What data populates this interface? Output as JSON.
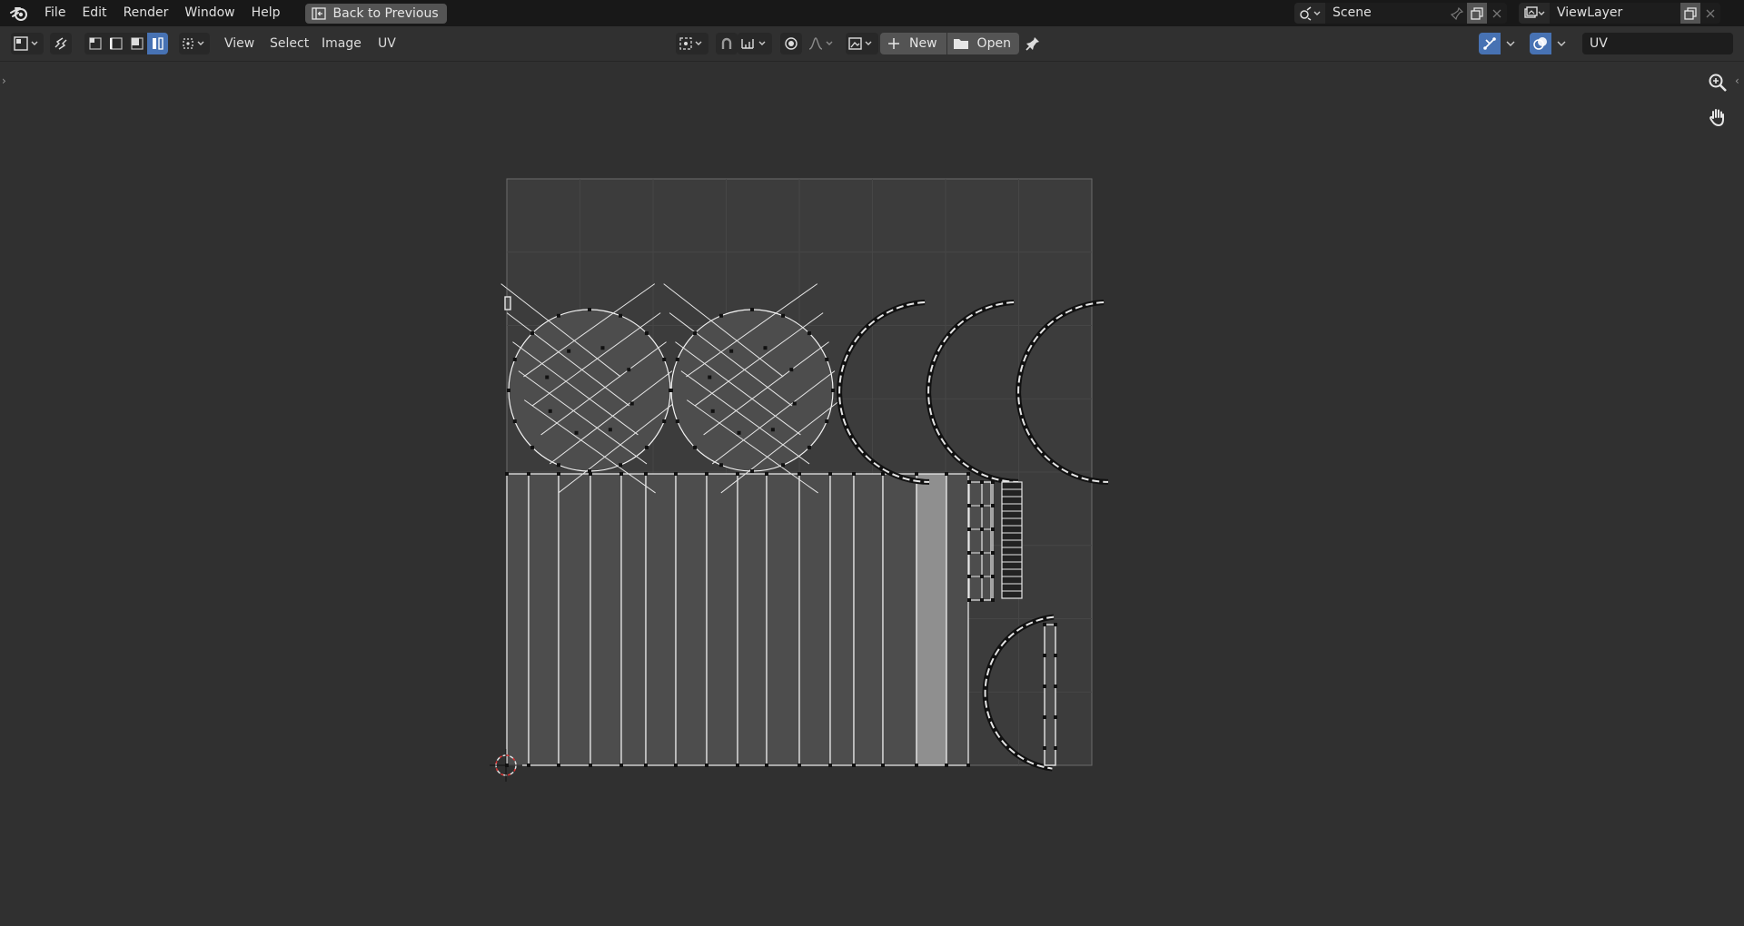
{
  "menu": {
    "file": "File",
    "edit": "Edit",
    "render": "Render",
    "window": "Window",
    "help": "Help",
    "back_to_previous": "Back to Previous"
  },
  "scene": {
    "name": "Scene"
  },
  "view_layer": {
    "name": "ViewLayer"
  },
  "header": {
    "view": "View",
    "select": "Select",
    "image": "Image",
    "uv": "UV",
    "new_label": "New",
    "open_label": "Open",
    "uv_map_name": "UV"
  },
  "colors": {
    "window_bg": "#303030",
    "topbar_bg": "#181818",
    "accent_blue": "#4772b3",
    "mesh_face": "#4d4d4d",
    "selected_face": "#8f8f8f"
  },
  "icons": {
    "app": "blender-logo-icon",
    "back": "back-to-previous-icon",
    "scene": "scene-icon",
    "pin": "pin-icon",
    "copy": "duplicate-icon",
    "close": "close-icon",
    "view_layer": "render-layers-icon",
    "editor_type": "uv-editor-icon",
    "sync": "uv-sync-selection-icon",
    "vertex_mode": "vertex-select-icon",
    "edge_mode": "edge-select-icon",
    "face_mode": "face-select-icon",
    "island_mode": "island-select-icon",
    "sticky": "sticky-selection-icon",
    "pivot": "pivot-point-icon",
    "snap": "snap-icon",
    "snap_target": "snap-increment-icon",
    "proportional": "proportional-edit-icon",
    "falloff": "falloff-curve-icon",
    "image_browse": "image-browse-icon",
    "pin_toggle": "pin-icon",
    "gizmo": "gizmo-icon",
    "overlay": "overlay-icon",
    "zoom": "zoom-icon",
    "pan": "hand-icon"
  }
}
